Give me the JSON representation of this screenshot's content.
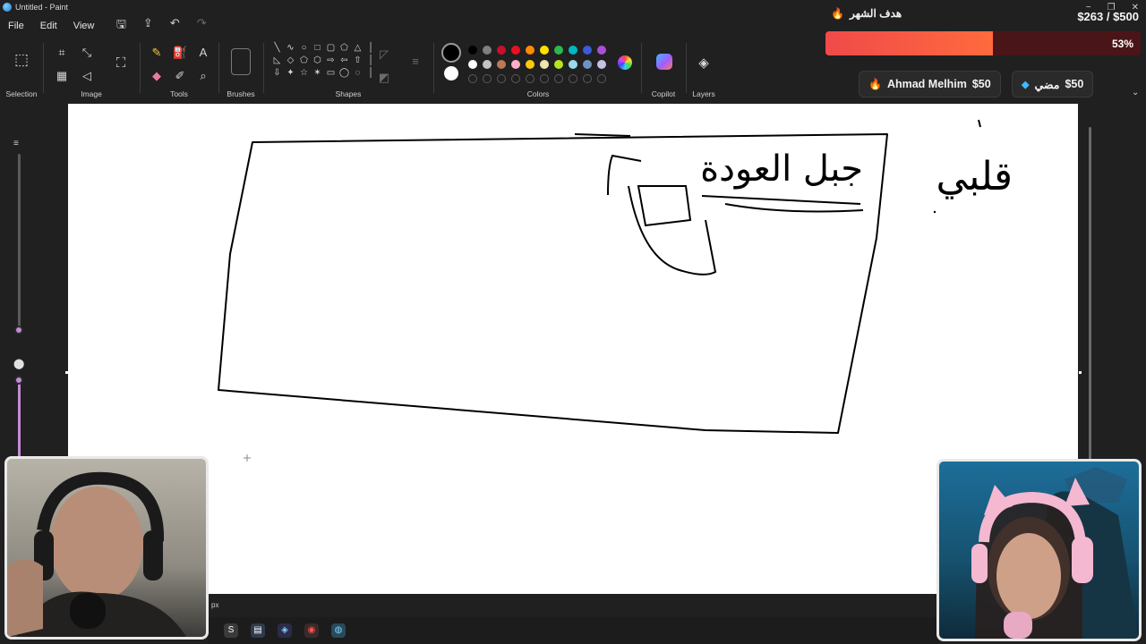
{
  "window": {
    "title": "Untitled - Paint"
  },
  "menu": {
    "file": "File",
    "edit": "Edit",
    "view": "View"
  },
  "ribbon": {
    "groups": {
      "selection": "Selection",
      "image": "Image",
      "tools": "Tools",
      "brushes": "Brushes",
      "shapes": "Shapes",
      "colors": "Colors",
      "copilot": "Copilot",
      "layers": "Layers"
    },
    "primary_color": "#000000",
    "secondary_color": "#ffffff",
    "palette_row1": [
      "#000000",
      "#7f7f7f",
      "#c8102e",
      "#e81123",
      "#ff8c00",
      "#ffe100",
      "#2db84d",
      "#00b7c3",
      "#3b5bdb",
      "#a94fd6"
    ],
    "palette_row2": [
      "#ffffff",
      "#c3c3c3",
      "#b97a57",
      "#ffaec9",
      "#ffc90e",
      "#efe4b0",
      "#b5e61d",
      "#99d9ea",
      "#7092be",
      "#c8bfe7"
    ]
  },
  "overlay": {
    "goal_title": "هدف الشهر",
    "goal_amount": "$263 / $500",
    "goal_progress": 0.53,
    "goal_percent": "53%",
    "donors": [
      {
        "name": "Ahmad Melhim",
        "amount": "$50",
        "icon": "fire-icon"
      },
      {
        "name": "مضي",
        "amount": "$50",
        "icon": "diamond-icon"
      }
    ]
  },
  "canvas": {
    "drawn_texts": [
      "جبل العودة",
      "قلبي"
    ]
  },
  "status": {
    "unit": "px"
  }
}
